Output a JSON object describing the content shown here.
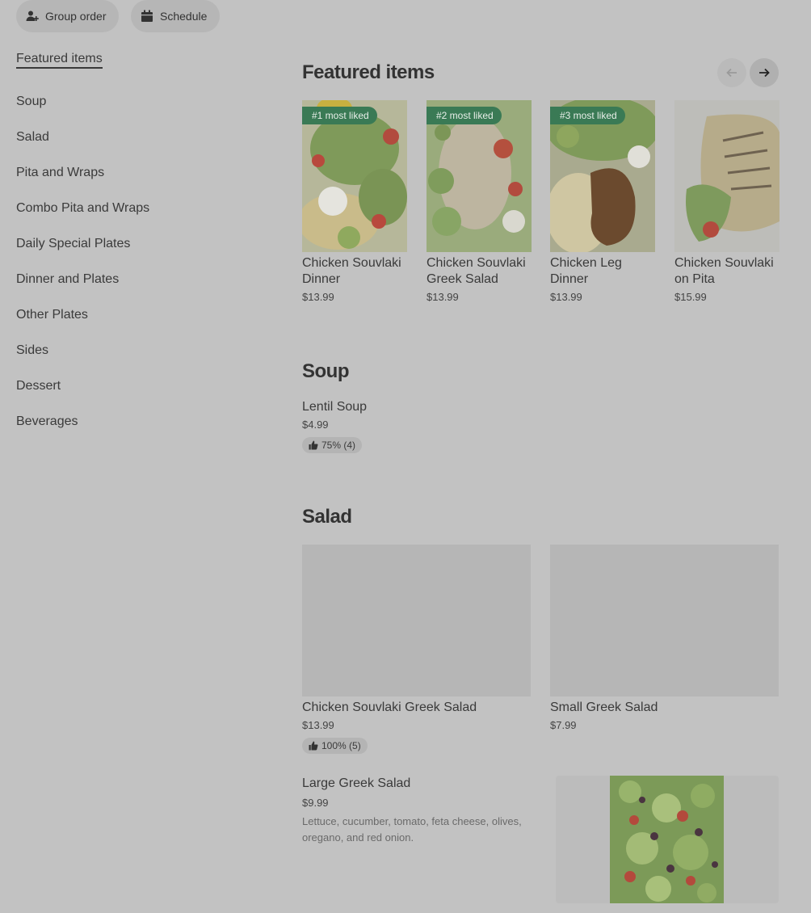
{
  "header": {
    "group_order_label": "Group order",
    "schedule_label": "Schedule"
  },
  "sidebar": {
    "items": [
      {
        "label": "Featured items"
      },
      {
        "label": "Soup"
      },
      {
        "label": "Salad"
      },
      {
        "label": "Pita and Wraps"
      },
      {
        "label": "Combo Pita and Wraps"
      },
      {
        "label": "Daily Special Plates"
      },
      {
        "label": "Dinner and Plates"
      },
      {
        "label": "Other Plates"
      },
      {
        "label": "Sides"
      },
      {
        "label": "Dessert"
      },
      {
        "label": "Beverages"
      }
    ]
  },
  "featured": {
    "title": "Featured items",
    "items": [
      {
        "badge": "#1 most liked",
        "name": "Chicken Souvlaki Dinner",
        "price": "$13.99"
      },
      {
        "badge": "#2 most liked",
        "name": "Chicken Souvlaki Greek Salad",
        "price": "$13.99"
      },
      {
        "badge": "#3 most liked",
        "name": "Chicken Leg Dinner",
        "price": "$13.99"
      },
      {
        "badge": "",
        "name": "Chicken Souvlaki on Pita",
        "price": "$15.99"
      }
    ]
  },
  "soup": {
    "title": "Soup",
    "items": [
      {
        "name": "Lentil Soup",
        "price": "$4.99",
        "rating": "75% (4)"
      }
    ]
  },
  "salad": {
    "title": "Salad",
    "items": [
      {
        "name": "Chicken Souvlaki Greek Salad",
        "price": "$13.99",
        "rating": "100% (5)"
      },
      {
        "name": "Small Greek Salad",
        "price": "$7.99"
      },
      {
        "name": "Large Greek Salad",
        "price": "$9.99",
        "description": "Lettuce, cucumber, tomato, feta cheese, olives, oregano, and red onion."
      }
    ]
  },
  "colors": {
    "background": "#c2c2c2",
    "badge": "#3a7a55"
  }
}
